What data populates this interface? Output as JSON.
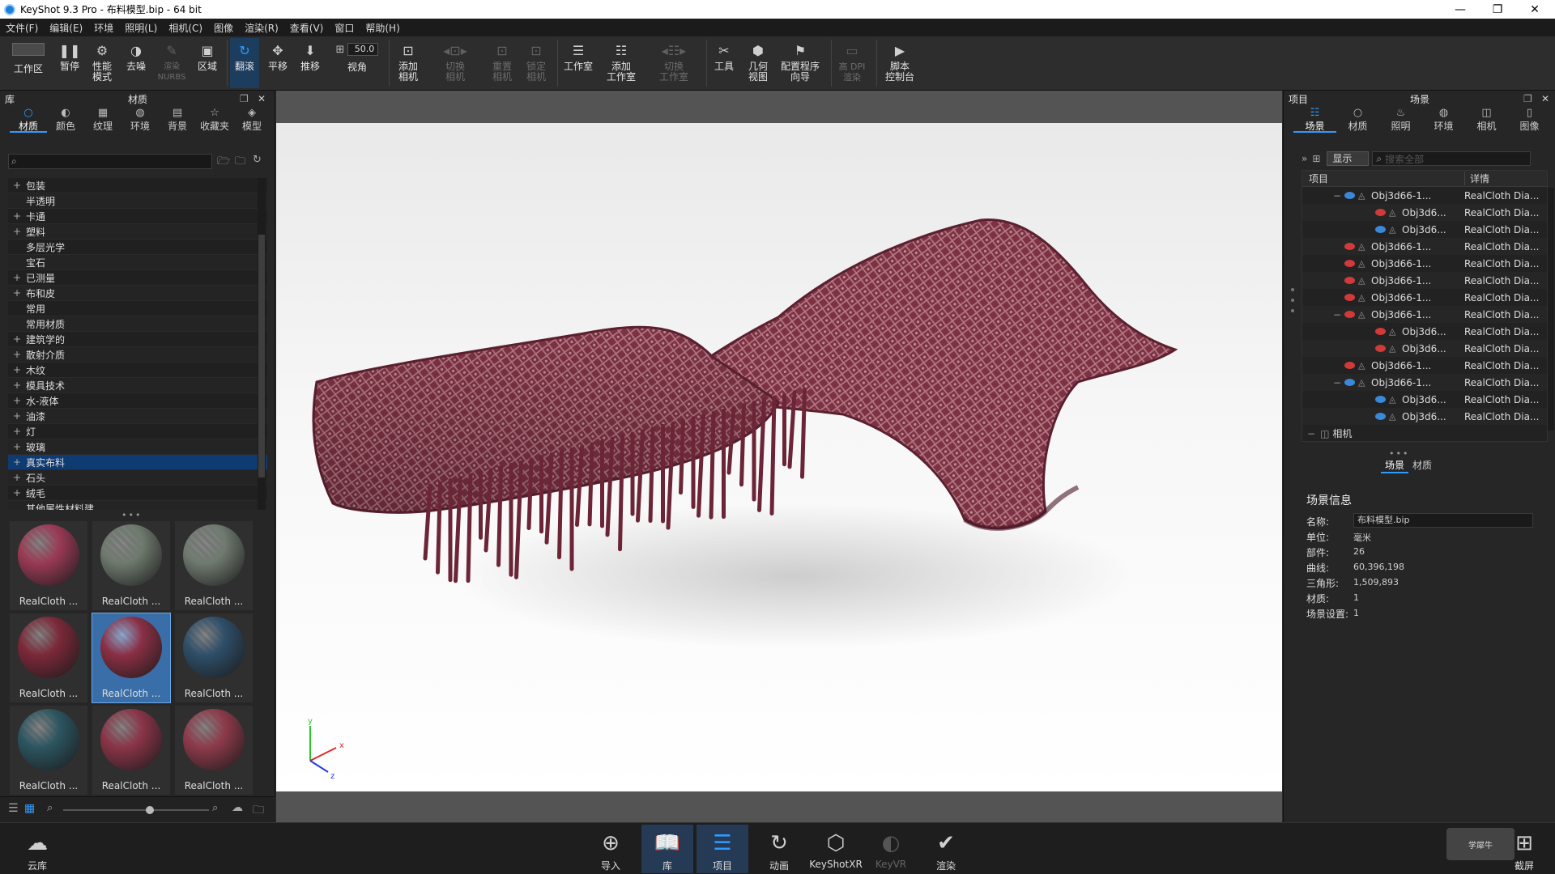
{
  "window": {
    "title": "KeyShot 9.3 Pro  - 布料模型.bip  - 64 bit"
  },
  "menu": [
    "文件(F)",
    "编辑(E)",
    "环境",
    "照明(L)",
    "相机(C)",
    "图像",
    "渲染(R)",
    "查看(V)",
    "窗口",
    "帮助(H)"
  ],
  "toolbar": {
    "items": [
      {
        "label": "工作区",
        "icon": "workspace-icon"
      },
      {
        "label": "暂停",
        "icon": "pause-icon"
      },
      {
        "label": "性能\n模式",
        "icon": "performance-icon"
      },
      {
        "label": "去噪",
        "icon": "denoise-icon"
      },
      {
        "label": "渲染\nNURBS",
        "icon": "nurbs-icon"
      },
      {
        "label": "区域",
        "icon": "region-icon"
      },
      {
        "label": "翻滚",
        "icon": "tumble-icon"
      },
      {
        "label": "平移",
        "icon": "pan-icon"
      },
      {
        "label": "推移",
        "icon": "dolly-icon"
      },
      {
        "label": "视角",
        "icon": "fov-icon"
      },
      {
        "label": "添加\n相机",
        "icon": "add-camera-icon"
      },
      {
        "label": "切换\n相机",
        "icon": "switch-camera-icon"
      },
      {
        "label": "重置\n相机",
        "icon": "reset-camera-icon"
      },
      {
        "label": "锁定\n相机",
        "icon": "lock-camera-icon"
      },
      {
        "label": "工作室",
        "icon": "studio-icon"
      },
      {
        "label": "添加\n工作室",
        "icon": "add-studio-icon"
      },
      {
        "label": "切换\n工作室",
        "icon": "switch-studio-icon"
      },
      {
        "label": "工具",
        "icon": "tools-icon"
      },
      {
        "label": "几何\n视图",
        "icon": "geometry-view-icon"
      },
      {
        "label": "配置程序\n向导",
        "icon": "configurator-icon"
      },
      {
        "label": "高 DPI\n渲染",
        "icon": "hidpi-icon"
      },
      {
        "label": "脚本\n控制台",
        "icon": "script-console-icon"
      }
    ],
    "fov_value": "50.0"
  },
  "library": {
    "panel_left": "库",
    "panel_title": "材质",
    "tabs": [
      "材质",
      "颜色",
      "纹理",
      "环境",
      "背景",
      "收藏夹",
      "模型"
    ],
    "tree": [
      {
        "label": "包装",
        "expand": "+"
      },
      {
        "label": "半透明",
        "expand": ""
      },
      {
        "label": "卡通",
        "expand": "+"
      },
      {
        "label": "塑料",
        "expand": "+"
      },
      {
        "label": "多层光学",
        "expand": ""
      },
      {
        "label": "宝石",
        "expand": ""
      },
      {
        "label": "已测量",
        "expand": "+"
      },
      {
        "label": "布和皮",
        "expand": "+"
      },
      {
        "label": "常用",
        "expand": ""
      },
      {
        "label": "常用材质",
        "expand": ""
      },
      {
        "label": "建筑学的",
        "expand": "+"
      },
      {
        "label": "散射介质",
        "expand": "+"
      },
      {
        "label": "木纹",
        "expand": "+"
      },
      {
        "label": "模具技术",
        "expand": "+"
      },
      {
        "label": "水-液体",
        "expand": "+"
      },
      {
        "label": "油漆",
        "expand": "+"
      },
      {
        "label": "灯",
        "expand": "+"
      },
      {
        "label": "玻璃",
        "expand": "+"
      },
      {
        "label": "真实布料",
        "expand": "+",
        "selected": true
      },
      {
        "label": "石头",
        "expand": "+"
      },
      {
        "label": "绒毛",
        "expand": "+"
      },
      {
        "label": "其他属性材料建",
        "expand": ""
      }
    ],
    "thumbs": [
      {
        "label": "RealCloth ...",
        "color": "#9a3a55"
      },
      {
        "label": "RealCloth ...",
        "color": "#6f7a6e"
      },
      {
        "label": "RealCloth ...",
        "color": "#707a70"
      },
      {
        "label": "RealCloth ...",
        "color": "#7b2838"
      },
      {
        "label": "RealCloth ...",
        "color": "#8a2f44",
        "selected": true
      },
      {
        "label": "RealCloth ...",
        "color": "#2e4e68"
      },
      {
        "label": "RealCloth ...",
        "color": "#2c5560"
      },
      {
        "label": "RealCloth ...",
        "color": "#8a3448"
      },
      {
        "label": "RealCloth ...",
        "color": "#8d3a4a"
      }
    ]
  },
  "project": {
    "panel_left": "项目",
    "panel_title": "场景",
    "tabs": [
      "场景",
      "材质",
      "照明",
      "环境",
      "相机",
      "图像"
    ],
    "display_label": "显示",
    "search_placeholder": "搜索全部",
    "columns": [
      "项目",
      "详情"
    ],
    "rows": [
      {
        "name": "Obj3d66-1...",
        "detail": "RealCloth Dia...",
        "indent": 1,
        "eye": "#3b88d8",
        "expand": "−"
      },
      {
        "name": "Obj3d6...",
        "detail": "RealCloth Dia...",
        "indent": 2,
        "eye": "#d23a3a",
        "expand": ""
      },
      {
        "name": "Obj3d6...",
        "detail": "RealCloth Dia...",
        "indent": 2,
        "eye": "#3b88d8",
        "expand": ""
      },
      {
        "name": "Obj3d66-1...",
        "detail": "RealCloth Dia...",
        "indent": 1,
        "eye": "#d23a3a",
        "expand": ""
      },
      {
        "name": "Obj3d66-1...",
        "detail": "RealCloth Dia...",
        "indent": 1,
        "eye": "#d23a3a",
        "expand": ""
      },
      {
        "name": "Obj3d66-1...",
        "detail": "RealCloth Dia...",
        "indent": 1,
        "eye": "#d23a3a",
        "expand": ""
      },
      {
        "name": "Obj3d66-1...",
        "detail": "RealCloth Dia...",
        "indent": 1,
        "eye": "#d23a3a",
        "expand": ""
      },
      {
        "name": "Obj3d66-1...",
        "detail": "RealCloth Dia...",
        "indent": 1,
        "eye": "#d23a3a",
        "expand": "−"
      },
      {
        "name": "Obj3d6...",
        "detail": "RealCloth Dia...",
        "indent": 2,
        "eye": "#d23a3a",
        "expand": ""
      },
      {
        "name": "Obj3d6...",
        "detail": "RealCloth Dia...",
        "indent": 2,
        "eye": "#d23a3a",
        "expand": ""
      },
      {
        "name": "Obj3d66-1...",
        "detail": "RealCloth Dia...",
        "indent": 1,
        "eye": "#d23a3a",
        "expand": ""
      },
      {
        "name": "Obj3d66-1...",
        "detail": "RealCloth Dia...",
        "indent": 1,
        "eye": "#3b88d8",
        "expand": "−"
      },
      {
        "name": "Obj3d6...",
        "detail": "RealCloth Dia...",
        "indent": 2,
        "eye": "#3b88d8",
        "expand": ""
      },
      {
        "name": "Obj3d6...",
        "detail": "RealCloth Dia...",
        "indent": 2,
        "eye": "#3b88d8",
        "expand": ""
      }
    ],
    "camera_node": "相机",
    "subtabs": [
      "场景",
      "材质"
    ],
    "info_title": "场景信息",
    "info": [
      {
        "k": "名称:",
        "v": "布料模型.bip"
      },
      {
        "k": "单位:",
        "v": "毫米"
      },
      {
        "k": "部件:",
        "v": "26"
      },
      {
        "k": "曲线:",
        "v": "60,396,198"
      },
      {
        "k": "三角形:",
        "v": "1,509,893"
      },
      {
        "k": "材质:",
        "v": "1"
      },
      {
        "k": "场景设置:",
        "v": "1"
      }
    ]
  },
  "bottombar": {
    "cloud": "云库",
    "items": [
      {
        "label": "导入",
        "icon": "import-icon"
      },
      {
        "label": "库",
        "icon": "library-book-icon",
        "selected": true
      },
      {
        "label": "项目",
        "icon": "project-list-icon",
        "selected": true
      },
      {
        "label": "动画",
        "icon": "animation-icon"
      },
      {
        "label": "KeyShotXR",
        "icon": "keyshotxr-icon"
      },
      {
        "label": "KeyVR",
        "icon": "keyvr-icon",
        "disabled": true
      },
      {
        "label": "渲染",
        "icon": "render-icon"
      }
    ],
    "screenshot": "截屏"
  },
  "colors": {
    "accent": "#2e9bff",
    "selection": "#0e3b72",
    "cloth": "#8a3a4c"
  }
}
